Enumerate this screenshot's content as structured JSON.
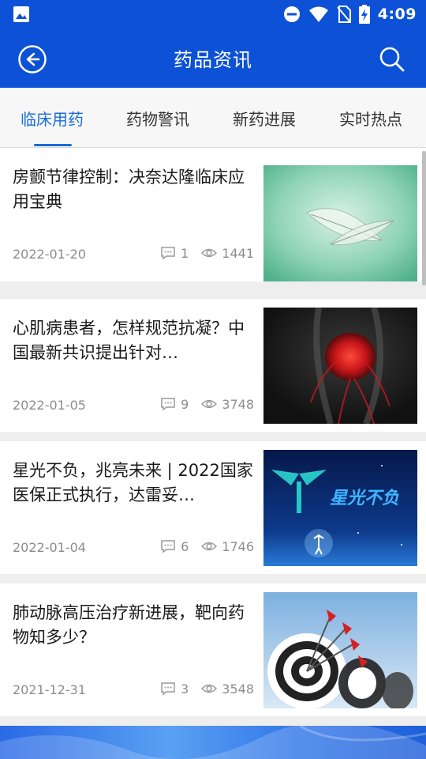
{
  "status_bar": {
    "time": "4:09",
    "icons": [
      "image-icon",
      "do-not-disturb-icon",
      "wifi-icon",
      "no-sim-icon",
      "battery-charging-icon"
    ]
  },
  "toolbar": {
    "title": "药品资讯",
    "back_icon": "back-arrow-icon",
    "search_icon": "search-icon"
  },
  "tabs": [
    {
      "label": "临床用药",
      "active": true
    },
    {
      "label": "药物警讯",
      "active": false
    },
    {
      "label": "新药进展",
      "active": false
    },
    {
      "label": "实时热点",
      "active": false
    }
  ],
  "articles": [
    {
      "title": "房颤节律控制：决奈达隆临床应用宝典",
      "date": "2022-01-20",
      "comments": "1",
      "views": "1441",
      "thumb": "leaf"
    },
    {
      "title": "心肌病患者，怎样规范抗凝？中国最新共识提出针对…",
      "date": "2022-01-05",
      "comments": "9",
      "views": "3748",
      "thumb": "heart"
    },
    {
      "title": "星光不负，兆亮未来 | 2022国家医保正式执行，达雷妥…",
      "date": "2022-01-04",
      "comments": "6",
      "views": "1746",
      "thumb": "stars",
      "thumb_text": "星光不负"
    },
    {
      "title": "肺动脉高压治疗新进展，靶向药物知多少？",
      "date": "2021-12-31",
      "comments": "3",
      "views": "3548",
      "thumb": "target"
    }
  ]
}
